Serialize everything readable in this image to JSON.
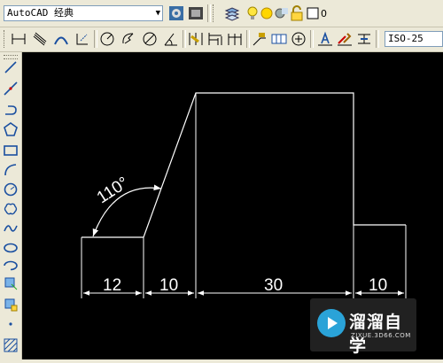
{
  "workspace": {
    "selected": "AutoCAD 经典"
  },
  "layer": {
    "current": "0"
  },
  "dim_style": {
    "current": "ISO-25"
  },
  "drawing": {
    "angle_label": "110°",
    "dimensions": [
      "12",
      "10",
      "30",
      "10"
    ]
  },
  "watermark": {
    "brand": "溜溜自学",
    "url": "ZIXUE.3D66.COM"
  },
  "colors": {
    "canvas": "#000000",
    "geometry": "#ffffff",
    "ui": "#ece9d8",
    "watermark_logo": "#2aa3d8"
  },
  "icons": {
    "row1": [
      "workspace-settings-icon",
      "customize-workspace-icon",
      "layer-manager-icon",
      "bulb-on-icon",
      "sun-freeze-icon",
      "lock-icon",
      "color-swatch-icon"
    ],
    "row2": [
      "linear-dim-icon",
      "aligned-dim-icon",
      "arc-length-icon",
      "ordinate-dim-icon",
      "radius-dim-icon",
      "jogged-dim-icon",
      "diameter-dim-icon",
      "angular-dim-icon",
      "quick-dim-icon",
      "baseline-dim-icon",
      "continue-dim-icon",
      "leader-icon",
      "tolerance-icon",
      "center-mark-icon",
      "dimedit-icon",
      "dimtedit-icon",
      "update-icon"
    ],
    "left": [
      "line-icon",
      "construction-line-icon",
      "polyline-icon",
      "polygon-icon",
      "rectangle-icon",
      "arc-icon",
      "circle-icon",
      "revcloud-icon",
      "spline-icon",
      "ellipse-icon",
      "ellipse-arc-icon",
      "insert-block-icon",
      "make-block-icon",
      "point-icon",
      "hatch-icon"
    ]
  }
}
